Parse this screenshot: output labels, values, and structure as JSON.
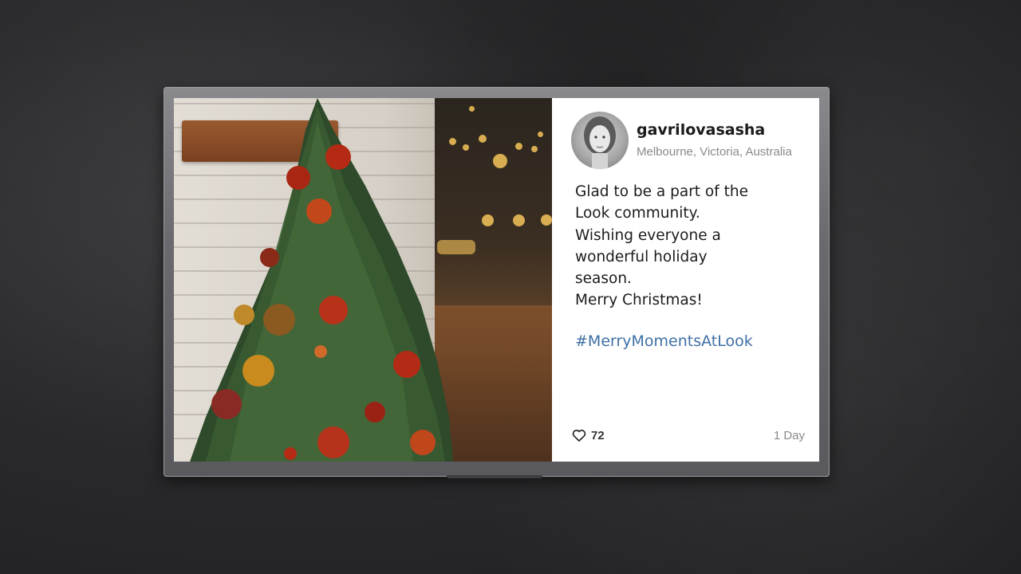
{
  "post": {
    "username": "gavrilovasasha",
    "location": "Melbourne, Victoria, Australia",
    "caption": "Glad to be a part of the\nLook community.\nWishing everyone a\nwonderful holiday\nseason.\nMerry Christmas!",
    "hashtag": "#MerryMomentsAtLook",
    "likes": "72",
    "time_ago": "1 Day"
  },
  "icons": {
    "like": "heart-icon"
  },
  "colors": {
    "hashtag": "#3d6fa4",
    "meta_text": "#8a8a8a",
    "card_background": "#ffffff",
    "wall": "#2a2a2c"
  }
}
